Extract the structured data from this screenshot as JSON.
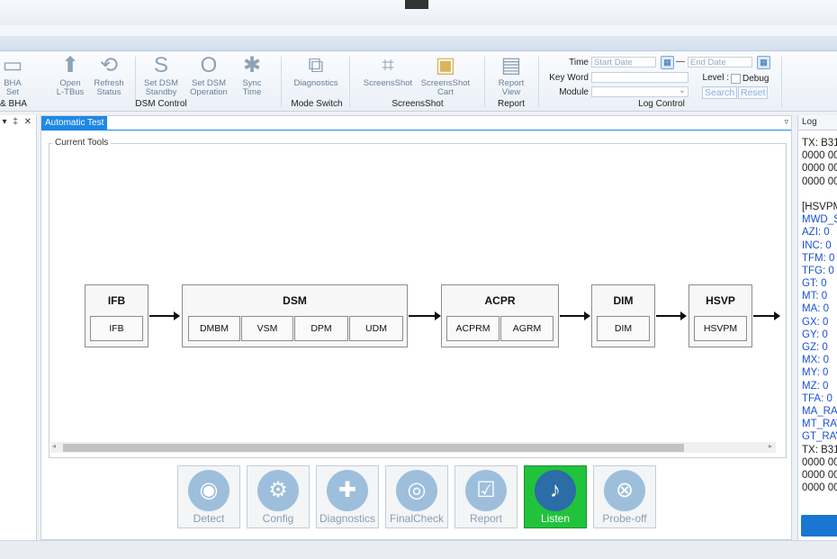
{
  "ribbon": {
    "buttons": [
      {
        "label": "BHA\nSet",
        "icon": "bha-icon"
      },
      {
        "label": "Open\nL-TBus",
        "icon": "open-ltbus-icon"
      },
      {
        "label": "Refresh\nStatus",
        "icon": "refresh-icon"
      },
      {
        "label": "Set DSM\nStandby",
        "icon": "S"
      },
      {
        "label": "Set DSM\nOperation",
        "icon": "O"
      },
      {
        "label": "Sync\nTime",
        "icon": "sync-icon"
      },
      {
        "label": "Diagnostics",
        "icon": "diagnostics-icon"
      },
      {
        "label": "ScreensShot",
        "icon": "crop-icon"
      },
      {
        "label": "ScreensShot\nCart",
        "icon": "folder-icon"
      },
      {
        "label": "Report\nView",
        "icon": "report-icon"
      }
    ],
    "groups": [
      "& BHA",
      "DSM Control",
      "Mode Switch",
      "ScreensShot",
      "Report",
      "Log Control"
    ],
    "icon_glyphs": {
      "bha": "▭",
      "open": "⬆",
      "refresh": "⟲",
      "S": "S",
      "O": "O",
      "sync": "✱",
      "diag": "⧉",
      "crop": "⌗",
      "folder": "▣",
      "report": "▤",
      "cal": "▦"
    },
    "log_control": {
      "time_label": "Time",
      "start_placeholder": "Start Date",
      "dash": "—",
      "end_placeholder": "End Date",
      "keyword_label": "Key Word",
      "level_label": "Level :",
      "debug_label": "Debug",
      "module_label": "Module",
      "search_label": "Search",
      "reset_label": "Reset",
      "dropdown_arrow": "⌄"
    }
  },
  "left_panel": {
    "controls": "▾ ‡ ✕"
  },
  "main": {
    "tab": "Automatic Test",
    "tab_menu": "▿",
    "current_tools_label": "Current Tools",
    "modules": [
      {
        "title": "IFB",
        "subs": [
          "IFB"
        ]
      },
      {
        "title": "DSM",
        "subs": [
          "DMBM",
          "VSM",
          "DPM",
          "UDM"
        ]
      },
      {
        "title": "ACPR",
        "subs": [
          "ACPRM",
          "AGRM"
        ]
      },
      {
        "title": "DIM",
        "subs": [
          "DIM"
        ]
      },
      {
        "title": "HSVP",
        "subs": [
          "HSVPM"
        ]
      }
    ],
    "scroll_left": "◂",
    "scroll_right": "▸",
    "actions": [
      {
        "label": "Detect",
        "glyph": "◉",
        "active": false
      },
      {
        "label": "Config",
        "glyph": "⚙",
        "active": false
      },
      {
        "label": "Diagnostics",
        "glyph": "✚",
        "active": false
      },
      {
        "label": "FinalCheck",
        "glyph": "◎",
        "active": false
      },
      {
        "label": "Report",
        "glyph": "☑",
        "active": false
      },
      {
        "label": "Listen",
        "glyph": "♪",
        "active": true
      },
      {
        "label": "Probe-off",
        "glyph": "⊗",
        "active": false
      }
    ]
  },
  "log": {
    "title": "Log",
    "lines": [
      {
        "text": "TX: B31",
        "color": "#222222"
      },
      {
        "text": "0000 00",
        "color": "#222222"
      },
      {
        "text": "0000 00",
        "color": "#222222"
      },
      {
        "text": "0000 00",
        "color": "#222222"
      },
      {
        "text": "",
        "color": "#222222"
      },
      {
        "text": "[HSVPM",
        "color": "#222222"
      },
      {
        "text": "MWD_S",
        "color": "#1a4fd6"
      },
      {
        "text": "AZI: 0",
        "color": "#1a4fd6"
      },
      {
        "text": "INC: 0",
        "color": "#1a4fd6"
      },
      {
        "text": "TFM: 0",
        "color": "#1a4fd6"
      },
      {
        "text": "TFG: 0",
        "color": "#1a4fd6"
      },
      {
        "text": "GT: 0",
        "color": "#1a4fd6"
      },
      {
        "text": "MT: 0",
        "color": "#1a4fd6"
      },
      {
        "text": "MA: 0",
        "color": "#1a4fd6"
      },
      {
        "text": "GX: 0",
        "color": "#1a4fd6"
      },
      {
        "text": "GY: 0",
        "color": "#1a4fd6"
      },
      {
        "text": "GZ: 0",
        "color": "#1a4fd6"
      },
      {
        "text": "MX: 0",
        "color": "#1a4fd6"
      },
      {
        "text": "MY: 0",
        "color": "#1a4fd6"
      },
      {
        "text": "MZ: 0",
        "color": "#1a4fd6"
      },
      {
        "text": "TFA: 0",
        "color": "#1a4fd6"
      },
      {
        "text": "MA_RA",
        "color": "#1a4fd6"
      },
      {
        "text": "MT_RAV",
        "color": "#1a4fd6"
      },
      {
        "text": "GT_RAV",
        "color": "#1a4fd6"
      },
      {
        "text": "TX: B31",
        "color": "#222222"
      },
      {
        "text": "0000 00",
        "color": "#222222"
      },
      {
        "text": "0000 00",
        "color": "#222222"
      },
      {
        "text": "0000 00",
        "color": "#222222"
      }
    ]
  }
}
